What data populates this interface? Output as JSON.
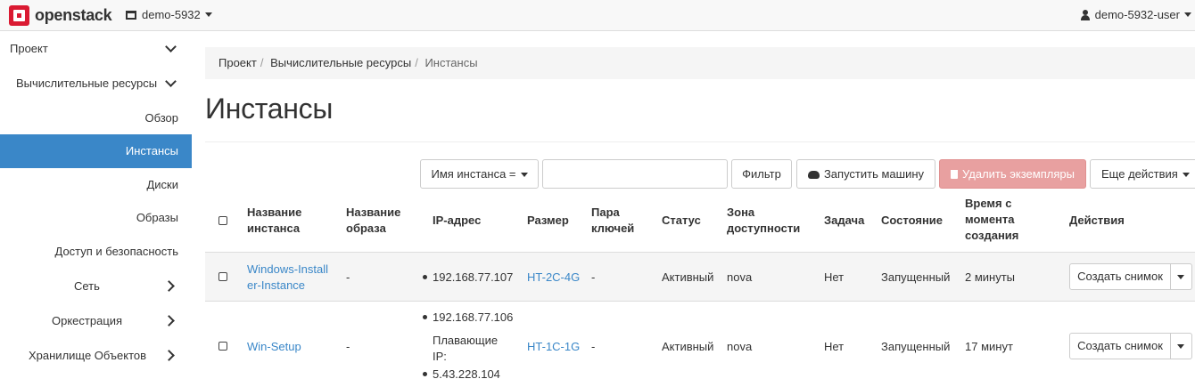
{
  "navbar": {
    "logo_text": "openstack",
    "project": "demo-5932",
    "user": "demo-5932-user"
  },
  "sidebar": {
    "items": [
      {
        "label": "Проект"
      },
      {
        "label": "Вычислительные ресурсы"
      },
      {
        "label": "Обзор"
      },
      {
        "label": "Инстансы"
      },
      {
        "label": "Диски"
      },
      {
        "label": "Образы"
      },
      {
        "label": "Доступ и безопасность"
      },
      {
        "label": "Сеть"
      },
      {
        "label": "Оркестрация"
      },
      {
        "label": "Хранилище Объектов"
      }
    ]
  },
  "breadcrumb": [
    "Проект",
    "Вычислительные ресурсы",
    "Инстансы"
  ],
  "page_title": "Инстансы",
  "toolbar": {
    "filter_field": "Имя инстанса =",
    "filter_value": "",
    "filter_button": "Фильтр",
    "launch_button": "Запустить машину",
    "delete_button": "Удалить экземпляры",
    "more_button": "Еще действия"
  },
  "table": {
    "headers": {
      "name": [
        "Название",
        "инстанса"
      ],
      "image": [
        "Название",
        "образа"
      ],
      "ip": "IP-адрес",
      "size": "Размер",
      "keypair": [
        "Пара",
        "ключей"
      ],
      "status": "Статус",
      "zone": [
        "Зона",
        "доступности"
      ],
      "task": "Задача",
      "state": "Состояние",
      "created": [
        "Время с",
        "момента",
        "создания"
      ],
      "actions": "Действия"
    },
    "rows": [
      {
        "name": [
          "Windows-Install",
          "er-Instance"
        ],
        "image": "-",
        "ips": [
          "192.168.77.107"
        ],
        "size": "HT-2C-4G",
        "keypair": "-",
        "status": "Активный",
        "zone": "nova",
        "task": "Нет",
        "state": "Запущенный",
        "created": "2 минуты",
        "action": "Создать снимок"
      },
      {
        "name": [
          "Win-Setup"
        ],
        "image": "-",
        "ips": [
          "192.168.77.106",
          "5.43.228.104"
        ],
        "floating_label": [
          "Плавающие",
          "IP:"
        ],
        "size": "HT-1C-1G",
        "keypair": "-",
        "status": "Активный",
        "zone": "nova",
        "task": "Нет",
        "state": "Запущенный",
        "created": "17 минут",
        "action": "Создать снимок"
      }
    ]
  },
  "colors": {
    "brand": "#da1a32",
    "active_nav": "#3a87c8",
    "link": "#3a87c8",
    "danger_disabled": "#e8a0a0"
  }
}
